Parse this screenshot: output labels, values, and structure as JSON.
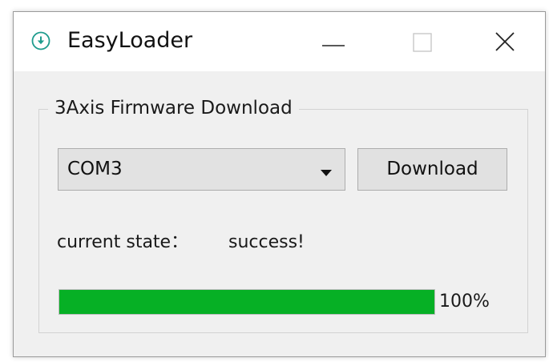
{
  "window": {
    "title": "EasyLoader",
    "icon": "download-circle-icon"
  },
  "group": {
    "title": "3Axis Firmware Download"
  },
  "port_select": {
    "value": "COM3"
  },
  "download_button": {
    "label": "Download"
  },
  "status": {
    "label": "current state：",
    "value": "success!"
  },
  "progress": {
    "value": 1.0,
    "text": "100%",
    "color": "#06b025"
  }
}
